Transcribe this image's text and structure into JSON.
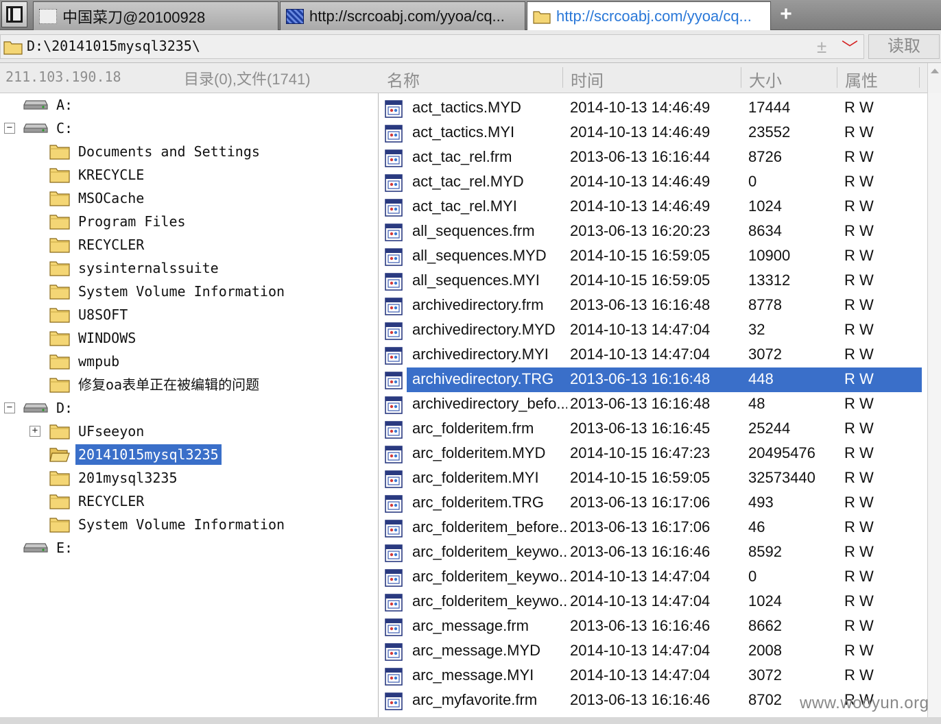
{
  "tabs": [
    {
      "label": "中国菜刀@20100928",
      "icon": "blank-page-icon"
    },
    {
      "label": "http://scrcoabj.com/yyoa/cq...",
      "icon": "web-shell-icon"
    },
    {
      "label": "http://scrcoabj.com/yyoa/cq...",
      "icon": "folder-icon"
    }
  ],
  "new_tab_label": "+",
  "address": {
    "path": "D:\\20141015mysql3235\\",
    "plus_glyph": "±",
    "dropdown_glyph": "﹀",
    "read_button": "读取"
  },
  "header": {
    "server_ip": "211.103.190.18",
    "summary": "目录(0),文件(1741)",
    "col_name": "名称",
    "col_time": "时间",
    "col_size": "大小",
    "col_attr": "属性"
  },
  "tree": [
    {
      "label": "A:",
      "type": "drive",
      "level": 0,
      "expander": ""
    },
    {
      "label": "C:",
      "type": "drive",
      "level": 0,
      "expander": "−"
    },
    {
      "label": "Documents and Settings",
      "type": "folder",
      "level": 1,
      "expander": ""
    },
    {
      "label": "KRECYCLE",
      "type": "folder",
      "level": 1,
      "expander": ""
    },
    {
      "label": "MSOCache",
      "type": "folder",
      "level": 1,
      "expander": ""
    },
    {
      "label": "Program Files",
      "type": "folder",
      "level": 1,
      "expander": ""
    },
    {
      "label": "RECYCLER",
      "type": "folder",
      "level": 1,
      "expander": ""
    },
    {
      "label": "sysinternalssuite",
      "type": "folder",
      "level": 1,
      "expander": ""
    },
    {
      "label": "System Volume Information",
      "type": "folder",
      "level": 1,
      "expander": ""
    },
    {
      "label": "U8SOFT",
      "type": "folder",
      "level": 1,
      "expander": ""
    },
    {
      "label": "WINDOWS",
      "type": "folder",
      "level": 1,
      "expander": ""
    },
    {
      "label": "wmpub",
      "type": "folder",
      "level": 1,
      "expander": ""
    },
    {
      "label": "修复oa表单正在被编辑的问题",
      "type": "folder",
      "level": 1,
      "expander": ""
    },
    {
      "label": "D:",
      "type": "drive",
      "level": 0,
      "expander": "−"
    },
    {
      "label": "UFseeyon",
      "type": "folder",
      "level": 1,
      "expander": "+"
    },
    {
      "label": "20141015mysql3235",
      "type": "folder-open",
      "level": 1,
      "expander": "",
      "selected": true
    },
    {
      "label": "201mysql3235",
      "type": "folder",
      "level": 1,
      "expander": ""
    },
    {
      "label": "RECYCLER",
      "type": "folder",
      "level": 1,
      "expander": ""
    },
    {
      "label": "System Volume Information",
      "type": "folder",
      "level": 1,
      "expander": ""
    },
    {
      "label": "E:",
      "type": "drive",
      "level": 0,
      "expander": ""
    }
  ],
  "files": [
    {
      "name": "act_tactics.MYD",
      "time": "2014-10-13 14:46:49",
      "size": "17444",
      "attr": "R W"
    },
    {
      "name": "act_tactics.MYI",
      "time": "2014-10-13 14:46:49",
      "size": "23552",
      "attr": "R W"
    },
    {
      "name": "act_tac_rel.frm",
      "time": "2013-06-13 16:16:44",
      "size": "8726",
      "attr": "R W"
    },
    {
      "name": "act_tac_rel.MYD",
      "time": "2014-10-13 14:46:49",
      "size": "0",
      "attr": "R W"
    },
    {
      "name": "act_tac_rel.MYI",
      "time": "2014-10-13 14:46:49",
      "size": "1024",
      "attr": "R W"
    },
    {
      "name": "all_sequences.frm",
      "time": "2013-06-13 16:20:23",
      "size": "8634",
      "attr": "R W"
    },
    {
      "name": "all_sequences.MYD",
      "time": "2014-10-15 16:59:05",
      "size": "10900",
      "attr": "R W"
    },
    {
      "name": "all_sequences.MYI",
      "time": "2014-10-15 16:59:05",
      "size": "13312",
      "attr": "R W"
    },
    {
      "name": "archivedirectory.frm",
      "time": "2013-06-13 16:16:48",
      "size": "8778",
      "attr": "R W"
    },
    {
      "name": "archivedirectory.MYD",
      "time": "2014-10-13 14:47:04",
      "size": "32",
      "attr": "R W"
    },
    {
      "name": "archivedirectory.MYI",
      "time": "2014-10-13 14:47:04",
      "size": "3072",
      "attr": "R W"
    },
    {
      "name": "archivedirectory.TRG",
      "time": "2013-06-13 16:16:48",
      "size": "448",
      "attr": "R W",
      "selected": true
    },
    {
      "name": "archivedirectory_befo...",
      "time": "2013-06-13 16:16:48",
      "size": "48",
      "attr": "R W"
    },
    {
      "name": "arc_folderitem.frm",
      "time": "2013-06-13 16:16:45",
      "size": "25244",
      "attr": "R W"
    },
    {
      "name": "arc_folderitem.MYD",
      "time": "2014-10-15 16:47:23",
      "size": "20495476",
      "attr": "R W"
    },
    {
      "name": "arc_folderitem.MYI",
      "time": "2014-10-15 16:59:05",
      "size": "32573440",
      "attr": "R W"
    },
    {
      "name": "arc_folderitem.TRG",
      "time": "2013-06-13 16:17:06",
      "size": "493",
      "attr": "R W"
    },
    {
      "name": "arc_folderitem_before...",
      "time": "2013-06-13 16:17:06",
      "size": "46",
      "attr": "R W"
    },
    {
      "name": "arc_folderitem_keywo...",
      "time": "2013-06-13 16:16:46",
      "size": "8592",
      "attr": "R W"
    },
    {
      "name": "arc_folderitem_keywo...",
      "time": "2014-10-13 14:47:04",
      "size": "0",
      "attr": "R W"
    },
    {
      "name": "arc_folderitem_keywo...",
      "time": "2014-10-13 14:47:04",
      "size": "1024",
      "attr": "R W"
    },
    {
      "name": "arc_message.frm",
      "time": "2013-06-13 16:16:46",
      "size": "8662",
      "attr": "R W"
    },
    {
      "name": "arc_message.MYD",
      "time": "2014-10-13 14:47:04",
      "size": "2008",
      "attr": "R W"
    },
    {
      "name": "arc_message.MYI",
      "time": "2014-10-13 14:47:04",
      "size": "3072",
      "attr": "R W"
    },
    {
      "name": "arc_myfavorite.frm",
      "time": "2013-06-13 16:16:46",
      "size": "8702",
      "attr": "R W"
    }
  ],
  "watermark": "www.wooyun.org",
  "colors": {
    "selection": "#3a6fc9",
    "active_tab_text": "#2a78d8",
    "folder_yellow": "#f4d675",
    "header_text": "#8e8e8e"
  }
}
